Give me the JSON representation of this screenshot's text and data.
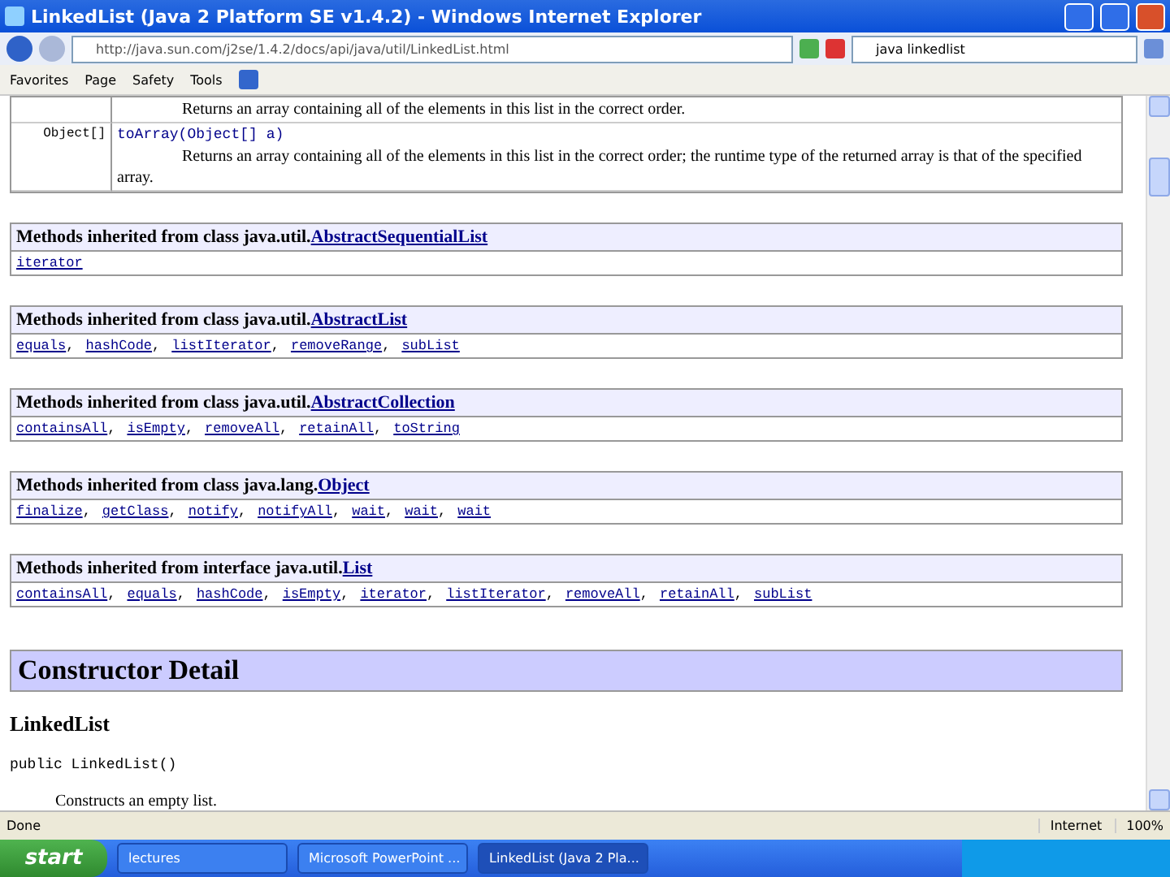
{
  "window": {
    "title": "LinkedList (Java 2 Platform SE v1.4.2) - Windows Internet Explorer"
  },
  "address": {
    "url": "http://java.sun.com/j2se/1.4.2/docs/api/java/util/LinkedList.html"
  },
  "search": {
    "value": "java linkedlist"
  },
  "toolbar": [
    "Favorites",
    "Page",
    "Safety",
    "Tools"
  ],
  "summary_rows": [
    {
      "type": "",
      "signature": "",
      "description": "Returns an array containing all of the elements in this list in the correct order."
    },
    {
      "type": "Object[]",
      "signature": "toArray(Object[] a)",
      "description": "Returns an array containing all of the elements in this list in the correct order; the runtime type of the returned array is that of the specified array."
    }
  ],
  "inherited": [
    {
      "prefix": "Methods inherited from class java.util.",
      "link": "AbstractSequentialList",
      "methods": [
        "iterator"
      ]
    },
    {
      "prefix": "Methods inherited from class java.util.",
      "link": "AbstractList",
      "methods": [
        "equals",
        "hashCode",
        "listIterator",
        "removeRange",
        "subList"
      ],
      "separator": ","
    },
    {
      "prefix": "Methods inherited from class java.util.",
      "link": "AbstractCollection",
      "methods": [
        "containsAll",
        "isEmpty",
        "removeAll",
        "retainAll",
        "toString"
      ],
      "separator": ","
    },
    {
      "prefix": "Methods inherited from class java.lang.",
      "link": "Object",
      "methods": [
        "finalize",
        "getClass",
        "notify",
        "notifyAll",
        "wait",
        "wait",
        "wait"
      ],
      "separator": ","
    },
    {
      "prefix": "Methods inherited from interface java.util.",
      "link": "List",
      "methods": [
        "containsAll",
        "equals",
        "hashCode",
        "isEmpty",
        "iterator",
        "listIterator",
        "removeAll",
        "retainAll",
        "subList"
      ],
      "separator": ","
    }
  ],
  "constructor_detail": {
    "heading": "Constructor Detail",
    "name": "LinkedList",
    "signature": "public LinkedList()",
    "description": "Constructs an empty list."
  },
  "status_bar": {
    "status": "Done",
    "zone": "Internet",
    "zoom": "100%"
  },
  "taskbar": {
    "start": "start",
    "tasks": [
      {
        "label": "lectures",
        "selected": false
      },
      {
        "label": "Microsoft PowerPoint ...",
        "selected": false
      },
      {
        "label": "LinkedList (Java 2 Pla...",
        "selected": true
      }
    ]
  }
}
